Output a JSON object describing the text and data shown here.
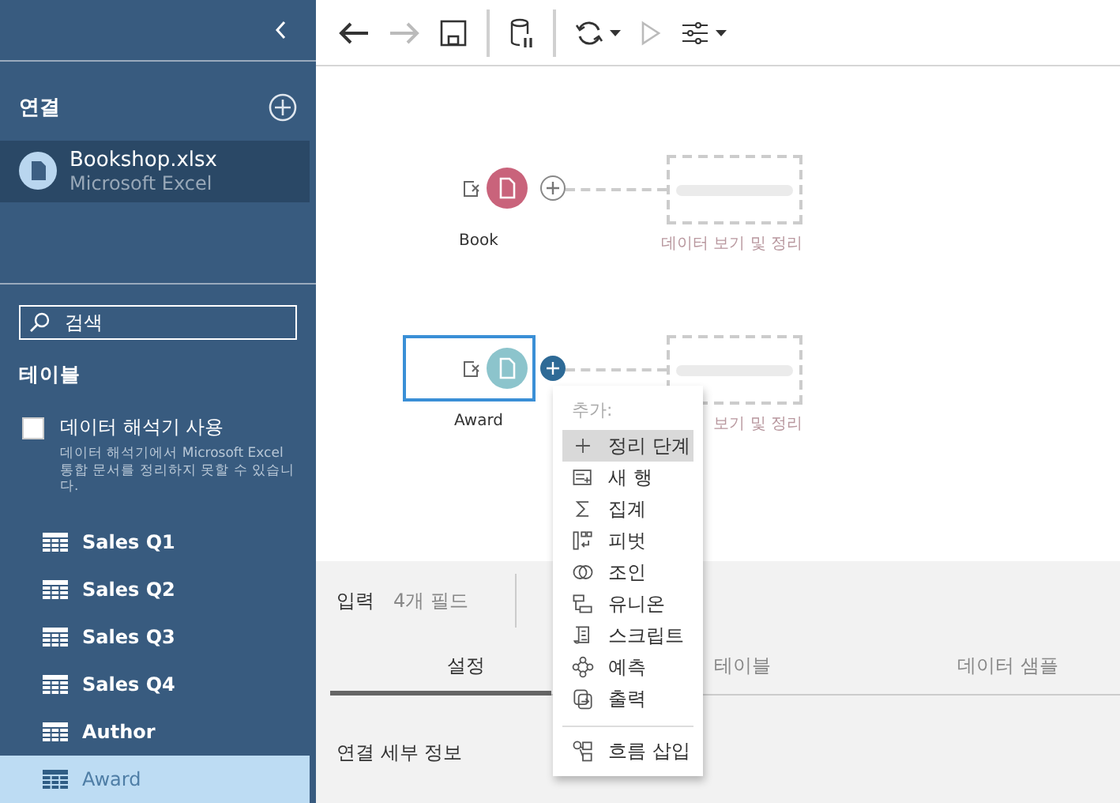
{
  "sidebar": {
    "connections_title": "연결",
    "connections": [
      {
        "name": "Bookshop.xlsx",
        "type": "Microsoft Excel",
        "selected": true
      }
    ],
    "search": {
      "placeholder": "검색"
    },
    "tables_title": "테이블",
    "interpreter": {
      "label": "데이터 해석기 사용",
      "checked": false,
      "description": "데이터 해석기에서 Microsoft Excel 통합 문서를 정리하지 못할 수 있습니다."
    },
    "tables": [
      {
        "name": "Sales Q1",
        "selected": false
      },
      {
        "name": "Sales Q2",
        "selected": false
      },
      {
        "name": "Sales Q3",
        "selected": false
      },
      {
        "name": "Sales Q4",
        "selected": false
      },
      {
        "name": "Author",
        "selected": false
      },
      {
        "name": "Award",
        "selected": true
      }
    ]
  },
  "toolbar": [
    {
      "buttons": [
        {
          "kind": "back",
          "disabled": false
        },
        {
          "kind": "forward",
          "disabled": true
        },
        {
          "kind": "save",
          "disabled": false
        }
      ]
    },
    {
      "buttons": [
        {
          "kind": "pause-data",
          "disabled": false
        }
      ]
    },
    {
      "buttons": [
        {
          "kind": "refresh",
          "disabled": false
        },
        {
          "kind": "run",
          "disabled": true
        },
        {
          "kind": "view",
          "disabled": false
        }
      ]
    }
  ],
  "flow": [
    {
      "name": "Book",
      "color": "#c9637b",
      "selected": false,
      "placeholder_label": "데이터 보기 및 정리"
    },
    {
      "name": "Award",
      "color": "#8cc4cc",
      "selected": true,
      "placeholder_label": "보기 및 정리"
    }
  ],
  "add_menu": {
    "title": "추가:",
    "items": [
      {
        "kind": "clean",
        "label": "정리 단계",
        "selected": true
      },
      {
        "kind": "new-rows",
        "label": "새 행",
        "selected": false
      },
      {
        "kind": "aggregate",
        "label": "집계",
        "selected": false
      },
      {
        "kind": "pivot",
        "label": "피벗",
        "selected": false
      },
      {
        "kind": "join",
        "label": "조인",
        "selected": false
      },
      {
        "kind": "union",
        "label": "유니온",
        "selected": false
      },
      {
        "kind": "script",
        "label": "스크립트",
        "selected": false
      },
      {
        "kind": "predict",
        "label": "예측",
        "selected": false
      },
      {
        "kind": "output",
        "label": "출력",
        "selected": false
      }
    ],
    "footer_items": [
      {
        "kind": "insert-flow",
        "label": "흐름 삽입",
        "selected": false
      }
    ]
  },
  "panel": {
    "title": "입력",
    "field_count": "4개 필드",
    "tabs": [
      {
        "label": "설정",
        "selected": true
      },
      {
        "label": "테이블",
        "selected": false
      },
      {
        "label": "데이터 샘플",
        "selected": false
      }
    ],
    "section_title": "연결 세부 정보"
  }
}
